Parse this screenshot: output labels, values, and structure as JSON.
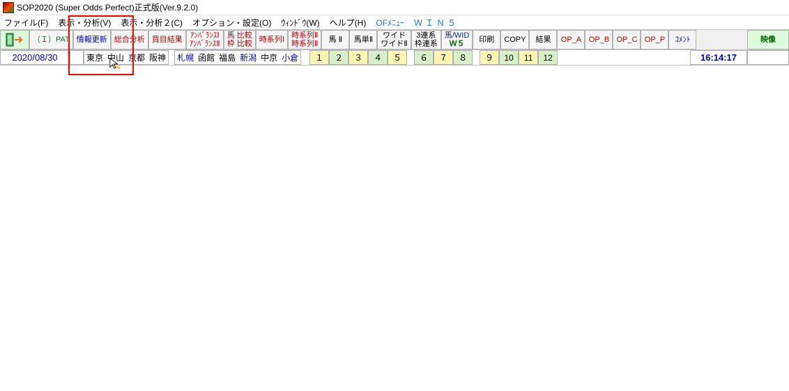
{
  "title": "SOP2020 (Super Odds Perfect)正式版(Ver.9.2.0)",
  "menu": {
    "file": "ファイル(F)",
    "view1": "表示・分析(V)",
    "view2": "表示・分析２(C)",
    "option": "オプション・設定(O)",
    "window": "ｳｨﾝﾄﾞｳ(W)",
    "help": "ヘルプ(H)",
    "ofmenu": "OFﾒﾆｭｰ",
    "win5": "ＷＩＮ５"
  },
  "toolbar": {
    "ipat": "（Ｉ）PAT",
    "update": "情報更新",
    "analysis": "総合分析",
    "buy": "買目結果",
    "unbal1": "ｱﾝﾊﾞﾗﾝｽⅠ",
    "unbal2": "ｱﾝﾊﾞﾗﾝｽⅡ",
    "umacmp": "馬 比較",
    "wakucmp": "枠 比較",
    "time1": "時系列Ⅰ",
    "time2a": "時系列Ⅱ",
    "time2b": "時系列Ⅱ",
    "uma2": "馬 Ⅱ",
    "umatan2": "馬単Ⅱ",
    "wide": "ワイド",
    "wide2": "ワイドⅡ",
    "sanren": "3連系",
    "wakuren": "枠連系",
    "umawid": "馬/WID",
    "w5": "Ｗ５",
    "print": "印刷",
    "copy": "COPY",
    "result": "結果",
    "opa": "OP_A",
    "opb": "OP_B",
    "opc": "OP_C",
    "opp": "OP_P",
    "comment": "ｺﾒﾝﾄ",
    "video": "映像"
  },
  "date": "2020/08/30",
  "tracks": {
    "t1": "東京",
    "t2": "中山",
    "t3": "京都",
    "t4": "阪神",
    "t5": "札幌",
    "t6": "函館",
    "t7": "福島",
    "t8": "新潟",
    "t9": "中京",
    "t10": "小倉"
  },
  "races": {
    "r1": "１",
    "r2": "２",
    "r3": "３",
    "r4": "４",
    "r5": "５",
    "r6": "６",
    "r7": "７",
    "r8": "８",
    "r9": "９",
    "r10": "10",
    "r11": "11",
    "r12": "12"
  },
  "clock": "16:14:17"
}
